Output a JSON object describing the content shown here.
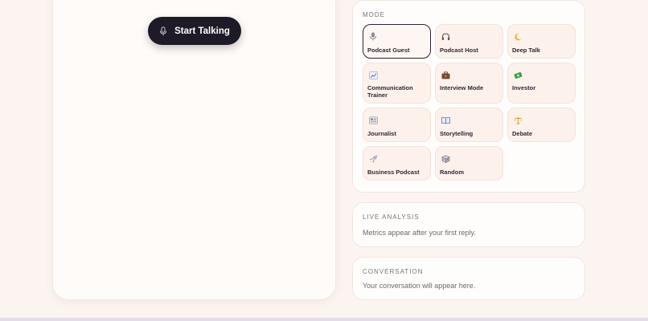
{
  "left_panel": {
    "start_button_label": "Start Talking"
  },
  "mode_card": {
    "title": "MODE",
    "selected": "Podcast Guest",
    "modes": [
      {
        "label": "Podcast Guest",
        "icon": "microphone-icon"
      },
      {
        "label": "Podcast Host",
        "icon": "headphones-icon"
      },
      {
        "label": "Deep Talk",
        "icon": "moon-icon"
      },
      {
        "label": "Communication Trainer",
        "icon": "chart-icon"
      },
      {
        "label": "Interview Mode",
        "icon": "briefcase-icon"
      },
      {
        "label": "Investor",
        "icon": "money-icon"
      },
      {
        "label": "Journalist",
        "icon": "newspaper-icon"
      },
      {
        "label": "Storytelling",
        "icon": "book-icon"
      },
      {
        "label": "Debate",
        "icon": "scales-icon"
      },
      {
        "label": "Business Podcast",
        "icon": "rocket-icon"
      },
      {
        "label": "Random",
        "icon": "dice-icon"
      }
    ]
  },
  "analysis_card": {
    "title": "LIVE ANALYSIS",
    "body": "Metrics appear after your first reply."
  },
  "conversation_card": {
    "title": "CONVERSATION",
    "body": "Your conversation will appear here."
  }
}
